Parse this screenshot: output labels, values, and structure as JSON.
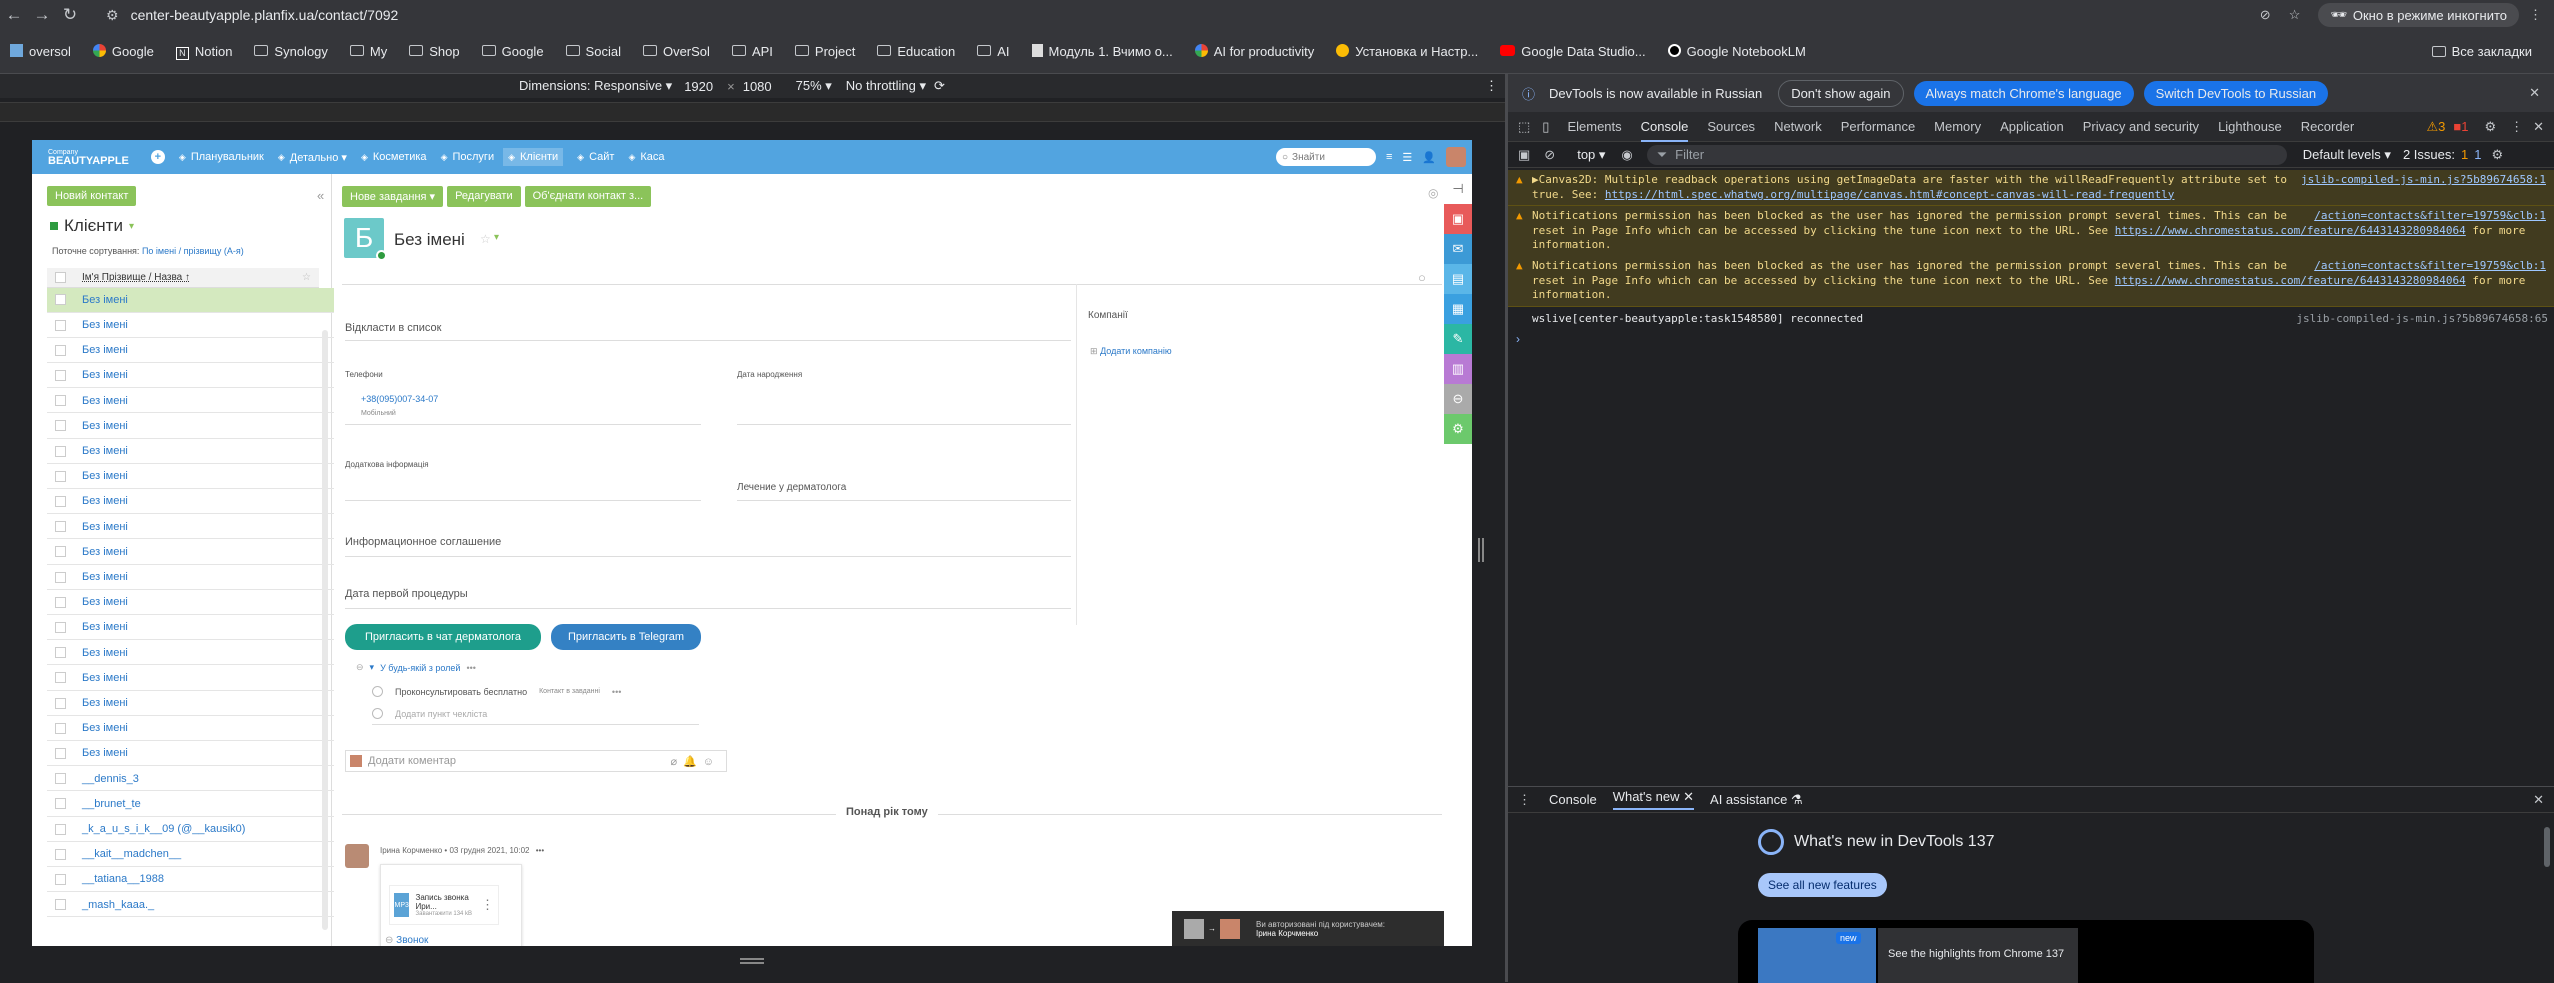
{
  "browser": {
    "url": "center-beautyapple.planfix.ua/contact/7092",
    "incognito": "Окно в режиме инкогнито",
    "all_bookmarks": "Все закладки",
    "bookmarks": [
      {
        "label": "oversol",
        "icon": "app-icon"
      },
      {
        "label": "Google",
        "icon": "google-icon"
      },
      {
        "label": "Notion",
        "icon": "notion-icon"
      },
      {
        "label": "Synology",
        "icon": "folder-icon"
      },
      {
        "label": "My",
        "icon": "folder-icon"
      },
      {
        "label": "Shop",
        "icon": "folder-icon"
      },
      {
        "label": "Google",
        "icon": "folder-icon"
      },
      {
        "label": "Social",
        "icon": "folder-icon"
      },
      {
        "label": "OverSol",
        "icon": "folder-icon"
      },
      {
        "label": "API",
        "icon": "folder-icon"
      },
      {
        "label": "Project",
        "icon": "folder-icon"
      },
      {
        "label": "Education",
        "icon": "folder-icon"
      },
      {
        "label": "AI",
        "icon": "folder-icon"
      },
      {
        "label": "Модуль 1. Вчимо о...",
        "icon": "page-icon"
      },
      {
        "label": "AI for productivity",
        "icon": "google-icon"
      },
      {
        "label": "Установка и Настр...",
        "icon": "smile-icon"
      },
      {
        "label": "Google Data Studio...",
        "icon": "youtube-icon"
      },
      {
        "label": "Google NotebookLM",
        "icon": "notebooklm-icon"
      }
    ]
  },
  "device_toolbar": {
    "dimensions_label": "Dimensions: Responsive ▾",
    "width": "1920",
    "x": "×",
    "height": "1080",
    "zoom": "75% ▾",
    "throttling": "No throttling ▾"
  },
  "app": {
    "company_small": "Company",
    "brand": "BEAUTYAPPLE",
    "nav": [
      "Планувальник",
      "Детально ▾",
      "Косметика",
      "Послуги",
      "Клієнти",
      "Сайт",
      "Каса"
    ],
    "search_placeholder": "Знайти",
    "new_contact": "Новий контакт",
    "list_title": "Клієнти",
    "sort_label": "Поточне сортування:",
    "sort_value": "По імені / прізвищу (А-я)",
    "col_header": "Ім'я Прізвище / Назва ↑",
    "rows": [
      "Без імені",
      "Без імені",
      "Без імені",
      "Без імені",
      "Без імені",
      "Без імені",
      "Без імені",
      "Без імені",
      "Без імені",
      "Без імені",
      "Без імені",
      "Без імені",
      "Без імені",
      "Без імені",
      "Без імені",
      "Без імені",
      "Без імені",
      "Без імені",
      "Без імені",
      "__dennis_3",
      "__brunet_te",
      "_k_a_u_s_i_k__09 (@__kausik0)",
      "__kait__madchen__",
      "__tatiana__1988",
      "_mash_kaaa._"
    ],
    "actions": [
      "Нове завдання ▾",
      "Редагувати",
      "Об'єднати контакт з..."
    ],
    "avatar_letter": "Б",
    "contact_name": "Без імені",
    "fields": {
      "sent_to_list": "Відкласти в список",
      "phones": "Телефони",
      "phone_value": "+38(095)007-34-07",
      "phone_type": "Мобільний",
      "birthday": "Дата народження",
      "extra_info": "Додаткова інформація",
      "derm": "Лечение у дерматолога",
      "info_agreement": "Информационное соглашение",
      "first_procedure": "Дата первой процедуры"
    },
    "buttons": {
      "invite_derm": "Пригласить в чат дерматолога",
      "invite_tg": "Пригласить в Telegram"
    },
    "checklist": {
      "title": "У будь-якій з ролей",
      "item1": "Проконсультировать бесплатно",
      "item1_tag": "Контакт в завданні",
      "add_item": "Додати пункт чекліста"
    },
    "companies": {
      "title": "Компанії",
      "add": "Додати компанію"
    },
    "comment_placeholder": "Додати коментар",
    "divider": "Понад рік тому",
    "comment": {
      "author": "Ірина Корчменко",
      "date": "• 03 грудня 2021, 10:02",
      "file": "Запись звонка Ири...",
      "file_meta": "Завантажити 134 kB",
      "file_ext": "MP3",
      "call": "Звонок"
    },
    "auth_text": "Ви авторизовані під користувачем:",
    "auth_user": "Ірина Корчменко"
  },
  "devtools": {
    "banner": "DevTools is now available in Russian",
    "dont_show": "Don't show again",
    "match_lang": "Always match Chrome's language",
    "switch": "Switch DevTools to Russian",
    "tabs": [
      "Elements",
      "Console",
      "Sources",
      "Network",
      "Performance",
      "Memory",
      "Application",
      "Privacy and security",
      "Lighthouse",
      "Recorder"
    ],
    "warn_count": "3",
    "err_count": "1",
    "context": "top ▾",
    "filter": "Filter",
    "levels": "Default levels ▾",
    "issues": "2 Issues:",
    "issues_warn": "1",
    "issues_info": "1",
    "messages": [
      {
        "text": "▶Canvas2D: Multiple readback operations using getImageData are faster with the willReadFrequently attribute set to true. See: ",
        "link": "https://html.spec.whatwg.org/multipage/canvas.html#concept-canvas-will-read-frequently",
        "src": "jslib-compiled-js-min.js?5b89674658:1"
      },
      {
        "text": "Notifications permission has been blocked as the user has ignored the permission prompt several times. This can be reset in Page Info which can be accessed by clicking the tune icon next to the URL. See ",
        "link": "https://www.chromestatus.com/feature/6443143280984064",
        "tail": " for more information.",
        "src": "/action=contacts&filter=19759&clb:1"
      },
      {
        "text": "Notifications permission has been blocked as the user has ignored the permission prompt several times. This can be reset in Page Info which can be accessed by clicking the tune icon next to the URL. See ",
        "link": "https://www.chromestatus.com/feature/6443143280984064",
        "tail": " for more information.",
        "src": "/action=contacts&filter=19759&clb:1"
      }
    ],
    "log": "wslive[center-beautyapple:task1548580] reconnected",
    "log_src": "jslib-compiled-js-min.js?5b89674658:65",
    "drawer_tabs": [
      "Console",
      "What's new",
      "AI assistance"
    ],
    "whats_new_title": "What's new in DevTools 137",
    "see_all": "See all new features",
    "highlight": "See the highlights from Chrome 137",
    "new_badge": "new"
  }
}
